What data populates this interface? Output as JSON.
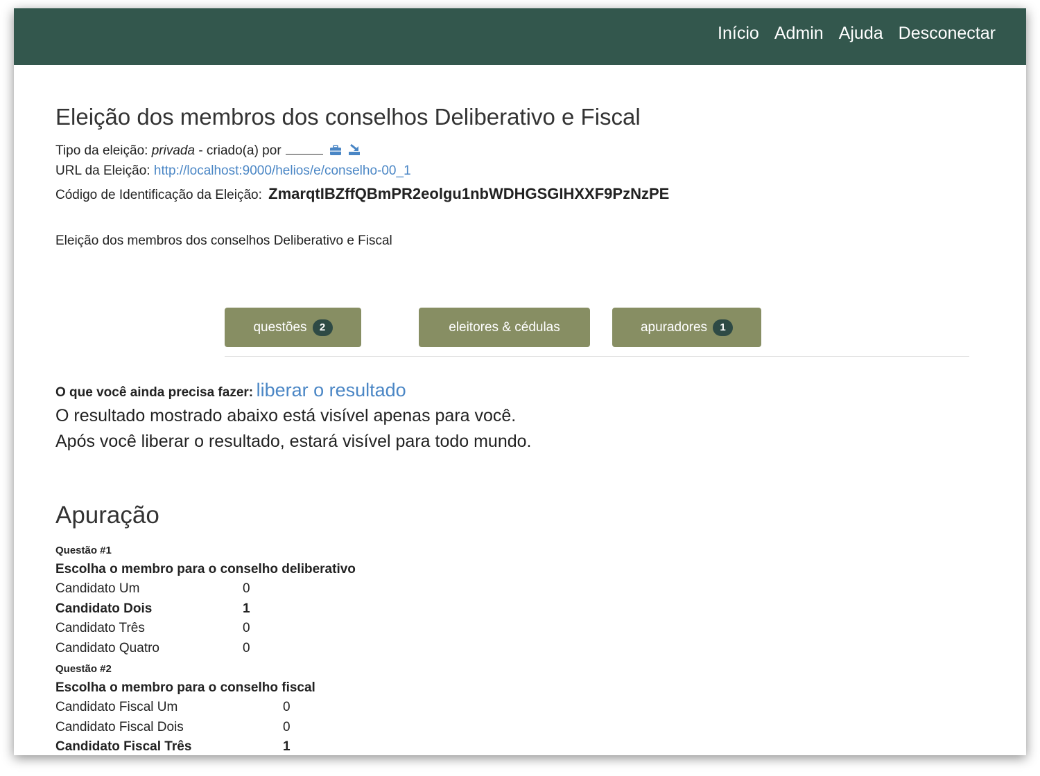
{
  "nav": {
    "links": [
      "Início",
      "Admin",
      "Ajuda",
      "Desconectar"
    ]
  },
  "election": {
    "title": "Eleição dos membros dos conselhos Deliberativo e Fiscal",
    "type_label": "Tipo da eleição:",
    "type_value": "privada",
    "created_by_label": "- criado(a) por",
    "url_label": "URL da Eleição:",
    "url_value": "http://localhost:9000/helios/e/conselho-00_1",
    "code_label": "Código de Identificação da Eleição:",
    "code_value": "ZmarqtIBZffQBmPR2eolgu1nbWDHGSGIHXXF9PzNzPE",
    "description": "Eleição dos membros dos conselhos Deliberativo e Fiscal"
  },
  "icons": {
    "edit": "briefcase-icon",
    "export": "download-icon"
  },
  "tabs": {
    "questions": {
      "label": "questões",
      "badge": "2"
    },
    "voters": {
      "label": "eleitores & cédulas"
    },
    "trustees": {
      "label": "apuradores",
      "badge": "1"
    }
  },
  "todo": {
    "label": "O que você ainda precisa fazer:",
    "link": "liberar o resultado",
    "line1": "O resultado mostrado abaixo está visível apenas para você.",
    "line2": "Após você liberar o resultado, estará visível para todo mundo."
  },
  "tally": {
    "title": "Apuração",
    "questions": [
      {
        "number": "Questão #1",
        "text": "Escolha o membro para o conselho deliberativo",
        "answers": [
          {
            "name": "Candidato Um",
            "count": "0",
            "winner": false
          },
          {
            "name": "Candidato Dois",
            "count": "1",
            "winner": true
          },
          {
            "name": "Candidato Três",
            "count": "0",
            "winner": false
          },
          {
            "name": "Candidato Quatro",
            "count": "0",
            "winner": false
          }
        ]
      },
      {
        "number": "Questão #2",
        "text": "Escolha o membro para o conselho fiscal",
        "answers": [
          {
            "name": "Candidato Fiscal Um",
            "count": "0",
            "winner": false
          },
          {
            "name": "Candidato Fiscal Dois",
            "count": "0",
            "winner": false
          },
          {
            "name": "Candidato Fiscal Três",
            "count": "1",
            "winner": true
          }
        ]
      }
    ]
  },
  "colors": {
    "navbar": "#33574d",
    "tab_button": "#878e63",
    "badge": "#2e4a45",
    "link": "#4a86c5"
  }
}
